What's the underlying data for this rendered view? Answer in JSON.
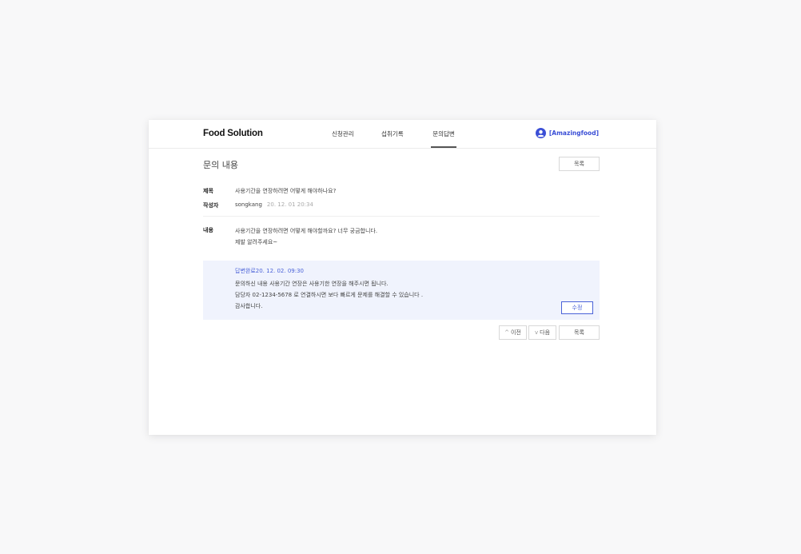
{
  "header": {
    "logo": "Food Solution",
    "nav": [
      "신청관리",
      "섭취기록",
      "문의답변"
    ],
    "active_nav": "문의답변",
    "user_label": "[Amazingfood]"
  },
  "page": {
    "title": "문의 내용",
    "list_button": "목록"
  },
  "inquiry": {
    "subject_label": "제목",
    "subject": "사용기간을 연장하려면 어떻게 해야하나요?",
    "author_label": "작성자",
    "author": "songkang",
    "date": "20. 12. 01 20:34",
    "content_label": "내용",
    "content_lines": [
      "사용기간을 연장하려면 어떻게 해야할까요? 너무 궁금합니다.",
      "제발 알려주세요~"
    ]
  },
  "answer": {
    "status_line": "답변완료20. 12. 02. 09:30",
    "lines": [
      "문의하신 내용 사용기간 연장은  사용기한 연장을 해주시면 됩니다.",
      "담당자 02-1234-5678 로 연결하시면 보다 빠르게 문제를 해결할 수 있습니다 .",
      "감사합니다."
    ],
    "edit_button": "수정"
  },
  "pager": {
    "prev": "이전",
    "next": "다음",
    "list": "목록"
  },
  "colors": {
    "accent": "#4a62d8",
    "answer_bg": "#f0f3fd",
    "page_bg": "#f8f8f9"
  }
}
